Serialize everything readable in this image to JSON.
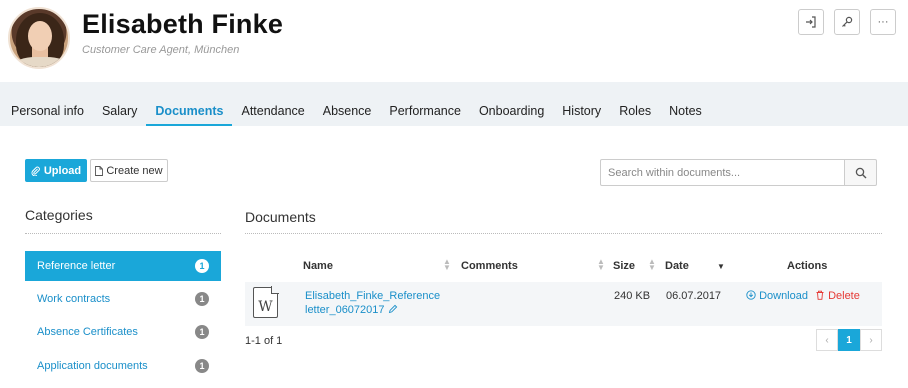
{
  "employee": {
    "name": "Elisabeth Finke",
    "subtitle": "Customer Care Agent, München"
  },
  "header_actions": [
    {
      "icon": "sign-in-icon"
    },
    {
      "icon": "key-icon"
    },
    {
      "icon": "more-icon",
      "label": "···"
    }
  ],
  "tabs": [
    {
      "label": "Personal info",
      "active": false
    },
    {
      "label": "Salary",
      "active": false
    },
    {
      "label": "Documents",
      "active": true
    },
    {
      "label": "Attendance",
      "active": false
    },
    {
      "label": "Absence",
      "active": false
    },
    {
      "label": "Performance",
      "active": false
    },
    {
      "label": "Onboarding",
      "active": false
    },
    {
      "label": "History",
      "active": false
    },
    {
      "label": "Roles",
      "active": false
    },
    {
      "label": "Notes",
      "active": false
    }
  ],
  "toolbar": {
    "upload_label": "Upload",
    "create_label": "Create new",
    "search_placeholder": "Search within documents..."
  },
  "categories": {
    "title": "Categories",
    "items": [
      {
        "label": "Reference letter",
        "count": "1",
        "active": true
      },
      {
        "label": "Work contracts",
        "count": "1",
        "active": false
      },
      {
        "label": "Absence Certificates",
        "count": "1",
        "active": false
      },
      {
        "label": "Application documents",
        "count": "1",
        "active": false
      }
    ]
  },
  "documents": {
    "title": "Documents",
    "columns": {
      "name": "Name",
      "comments": "Comments",
      "size": "Size",
      "date": "Date",
      "actions": "Actions"
    },
    "rows": [
      {
        "file_type": "W",
        "name_line1": "Elisabeth_Finke_Reference",
        "name_line2": "letter_06072017",
        "comments": "",
        "size": "240 KB",
        "date": "06.07.2017",
        "download_label": "Download",
        "delete_label": "Delete"
      }
    ],
    "pagination": {
      "summary": "1-1 of 1",
      "current_page": "1",
      "prev_label": "‹",
      "next_label": "›"
    }
  },
  "colors": {
    "accent": "#1aa7d9",
    "link": "#1a8fc9",
    "delete": "#e53935",
    "tab_bar": "#eef2f5"
  }
}
